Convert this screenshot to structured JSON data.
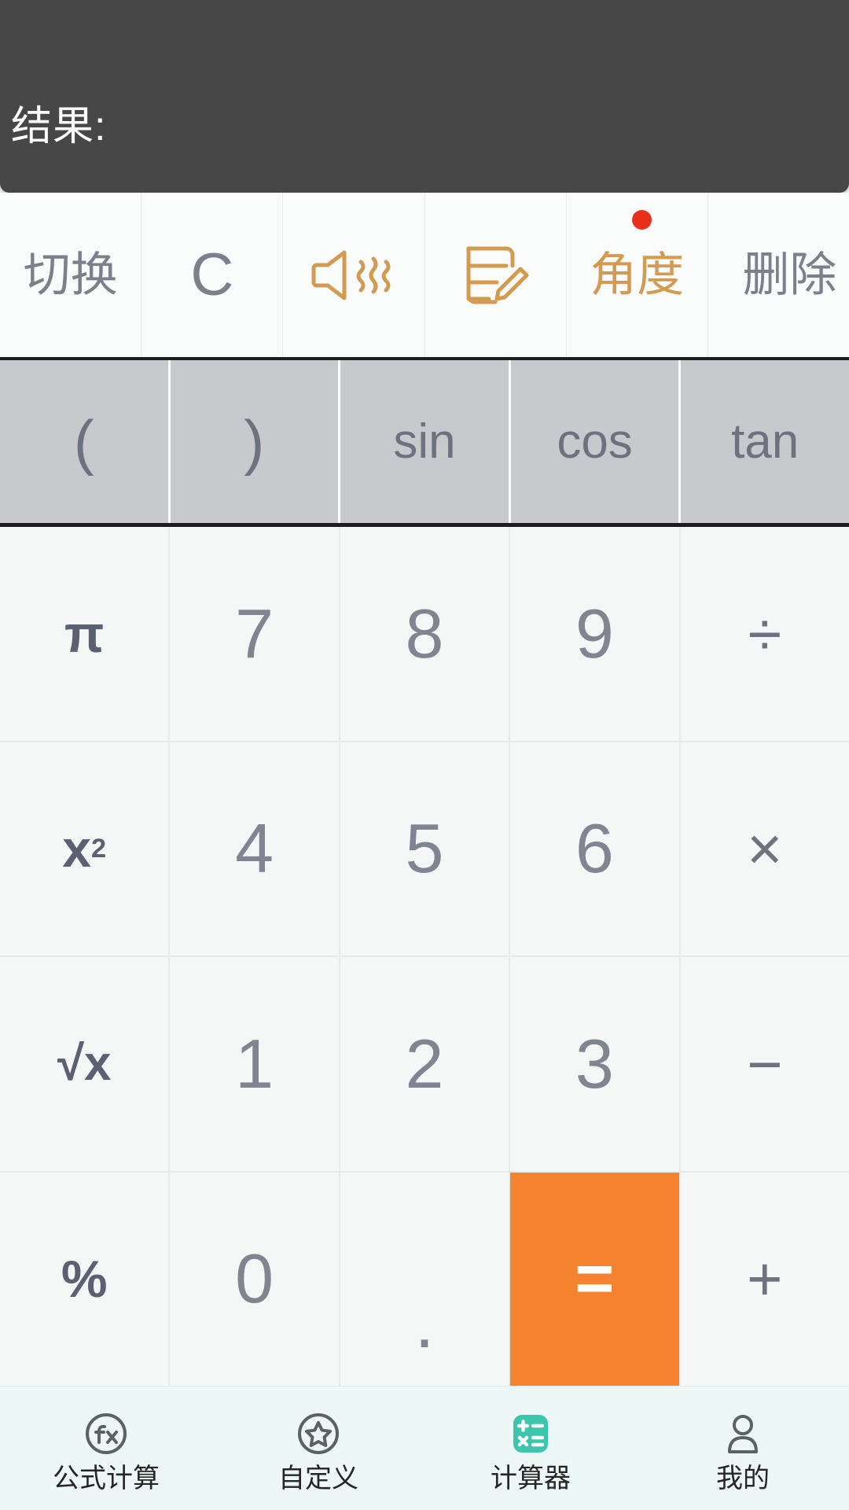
{
  "display": {
    "result_label": "结果:",
    "background_color": "#474747",
    "text_color": "#ffffff"
  },
  "toolbar": {
    "items": [
      {
        "label": "切换",
        "icon": null,
        "type": "text",
        "accent": false,
        "badge": false
      },
      {
        "label": "C",
        "icon": null,
        "type": "text-clear",
        "accent": false,
        "badge": false
      },
      {
        "label": "",
        "icon": "speaker-sound-icon",
        "type": "icon",
        "accent": true,
        "badge": false
      },
      {
        "label": "",
        "icon": "note-edit-icon",
        "type": "icon",
        "accent": true,
        "badge": false
      },
      {
        "label": "角度",
        "icon": null,
        "type": "text",
        "accent": true,
        "badge": true
      },
      {
        "label": "删除",
        "icon": null,
        "type": "text",
        "accent": false,
        "badge": false
      }
    ],
    "accent_color": "#d39b52",
    "badge_color": "#e8301d",
    "text_color": "#7c808b"
  },
  "function_row": {
    "items": [
      "(",
      ")",
      "sin",
      "cos",
      "tan"
    ],
    "background_color": "#c7c9cc",
    "text_color": "#6d727e"
  },
  "keypad": {
    "rows": [
      [
        {
          "label": "π",
          "kind": "fn"
        },
        {
          "label": "7",
          "kind": "digit"
        },
        {
          "label": "8",
          "kind": "digit"
        },
        {
          "label": "9",
          "kind": "digit"
        },
        {
          "label": "÷",
          "kind": "op"
        }
      ],
      [
        {
          "label": "x²",
          "kind": "fn-sup",
          "base": "x",
          "sup": "2"
        },
        {
          "label": "4",
          "kind": "digit"
        },
        {
          "label": "5",
          "kind": "digit"
        },
        {
          "label": "6",
          "kind": "digit"
        },
        {
          "label": "×",
          "kind": "op"
        }
      ],
      [
        {
          "label": "√x",
          "kind": "fn-sqrt"
        },
        {
          "label": "1",
          "kind": "digit"
        },
        {
          "label": "2",
          "kind": "digit"
        },
        {
          "label": "3",
          "kind": "digit"
        },
        {
          "label": "−",
          "kind": "op"
        }
      ],
      [
        {
          "label": "%",
          "kind": "fn"
        },
        {
          "label": "0",
          "kind": "digit"
        },
        {
          "label": ".",
          "kind": "dot"
        },
        {
          "label": "=",
          "kind": "equals"
        },
        {
          "label": "+",
          "kind": "op"
        }
      ]
    ],
    "equals_color": "#f5822e",
    "digit_color": "#808591",
    "function_color": "#5b6173",
    "key_background": "#f5f7f7"
  },
  "bottom_nav": {
    "background_color": "#edf7f5",
    "active_color": "#3cc6ae",
    "items": [
      {
        "label": "公式计算",
        "icon": "fx-circle-icon",
        "active": false
      },
      {
        "label": "自定义",
        "icon": "star-circle-icon",
        "active": false
      },
      {
        "label": "计算器",
        "icon": "calculator-icon",
        "active": true
      },
      {
        "label": "我的",
        "icon": "person-icon",
        "active": false
      }
    ]
  }
}
